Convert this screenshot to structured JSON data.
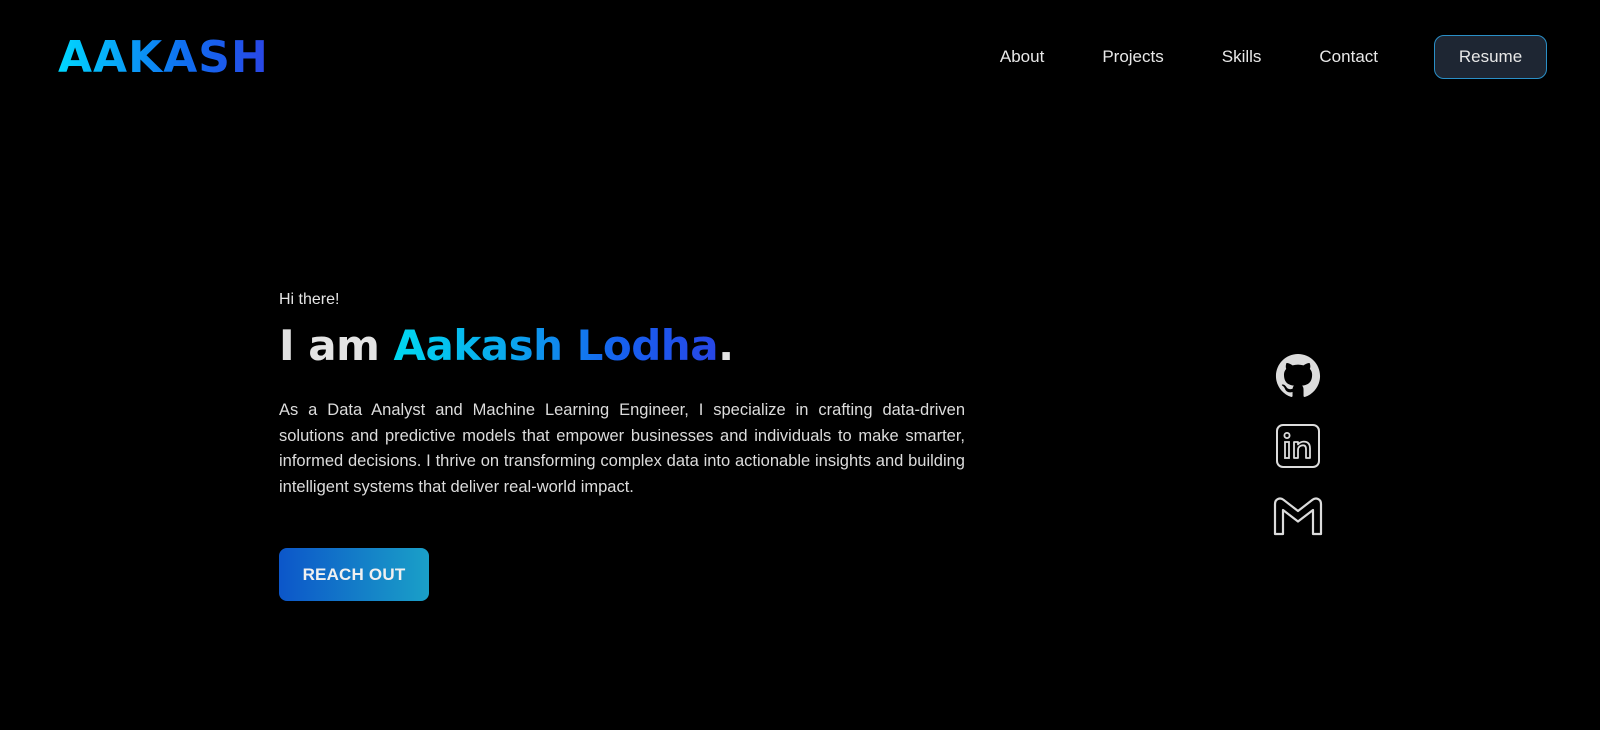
{
  "header": {
    "logo": "AAKASH",
    "nav": {
      "about": "About",
      "projects": "Projects",
      "skills": "Skills",
      "contact": "Contact",
      "resume": "Resume"
    }
  },
  "hero": {
    "greeting": "Hi there!",
    "headline_prefix": "I am ",
    "headline_name": "Aakash Lodha",
    "headline_suffix": ".",
    "bio": "As a Data Analyst and Machine Learning Engineer, I specialize in crafting data-driven solutions and predictive models that empower businesses and individuals to make smarter, informed decisions. I thrive on transforming complex data into actionable insights and building intelligent systems that deliver real-world impact.",
    "cta": "REACH OUT"
  },
  "social": {
    "icons": [
      "github-icon",
      "linkedin-icon",
      "gmail-icon"
    ]
  },
  "colors": {
    "background": "#000000",
    "accent_cyan": "#00d8ff",
    "accent_blue": "#2a45e6",
    "resume_border": "#2a8fc7",
    "resume_bg": "#1e2633"
  }
}
